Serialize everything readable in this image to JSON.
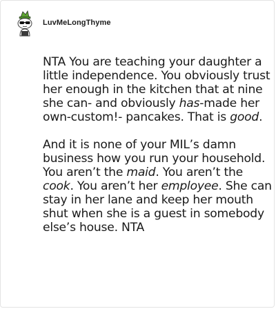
{
  "comment": {
    "username": "LuvMeLongThyme",
    "paragraphs": [
      [
        {
          "text": "NTA You are teaching your daughter a little independence. You obviously trust her enough in the kitchen that at nine she can- and obviously "
        },
        {
          "text": "has",
          "italic": true
        },
        {
          "text": "-made her own-custom!- pancakes. That is "
        },
        {
          "text": "good",
          "italic": true
        },
        {
          "text": "."
        }
      ],
      [
        {
          "text": "And it is none of your MIL’s damn business how you run your household. You aren’t the "
        },
        {
          "text": "maid",
          "italic": true
        },
        {
          "text": ". You aren’t the "
        },
        {
          "text": "cook",
          "italic": true
        },
        {
          "text": ". You aren’t her "
        },
        {
          "text": "employee",
          "italic": true
        },
        {
          "text": ". She can stay in her lane and keep her mouth shut when she is a guest in somebody else’s house. NTA"
        }
      ]
    ]
  },
  "avatar": {
    "icon": "snoo-avatar-with-sunglasses-and-green-hat",
    "colors": {
      "hat": "#5fa832",
      "face": "#ffffff",
      "sunglasses": "#111111",
      "outline": "#2b2b2b"
    }
  }
}
